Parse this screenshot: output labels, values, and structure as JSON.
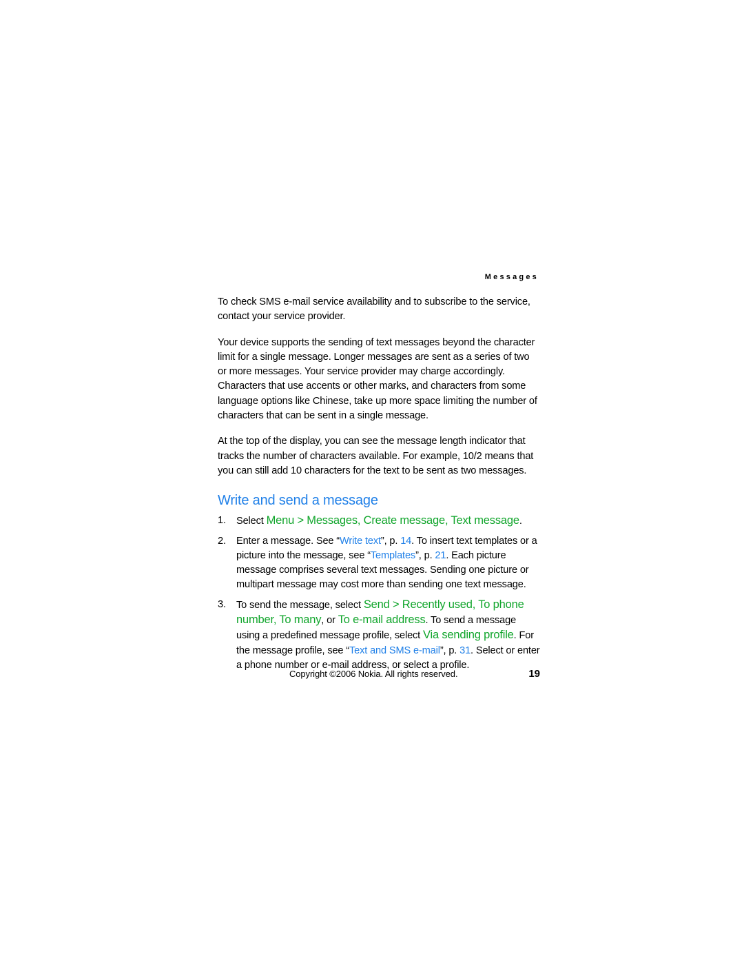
{
  "document": {
    "running_header": "Messages",
    "page_number": "19",
    "copyright": "Copyright ©2006 Nokia. All rights reserved."
  },
  "colors": {
    "heading_blue": "#2080e8",
    "link_blue": "#2080e8",
    "menu_green": "#10a52b",
    "body_black": "#000000",
    "page_background": "#ffffff"
  },
  "paragraphs": [
    {
      "id": "p1",
      "text": "To check SMS e-mail service availability and to subscribe to the service, contact your service provider."
    },
    {
      "id": "p2",
      "text": "Your device supports the sending of text messages beyond the character limit for a single message. Longer messages are sent as a series of two or more messages. Your service provider may charge accordingly. Characters that use accents or other marks, and characters from some language options like Chinese, take up more space limiting the number of characters that can be sent in a single message."
    },
    {
      "id": "p3",
      "text": "At the top of the display, you can see the message length indicator that tracks the number of characters available. For example, 10/2 means that you can still add 10 characters for the text to be sent as two messages."
    }
  ],
  "section": {
    "heading": "Write and send a message"
  },
  "steps": [
    {
      "number": "1.",
      "parts": [
        {
          "type": "text",
          "value": "Select "
        },
        {
          "type": "menu",
          "value": "Menu"
        },
        {
          "type": "menu",
          "value": " > "
        },
        {
          "type": "menu",
          "value": "Messages"
        },
        {
          "type": "menu",
          "value": ", "
        },
        {
          "type": "menu",
          "value": "Create message"
        },
        {
          "type": "menu",
          "value": ", "
        },
        {
          "type": "menu",
          "value": "Text message"
        },
        {
          "type": "text",
          "value": "."
        }
      ]
    },
    {
      "number": "2.",
      "parts": [
        {
          "type": "text",
          "value": "Enter a message. See “"
        },
        {
          "type": "link",
          "value": "Write text"
        },
        {
          "type": "text",
          "value": "”, p. "
        },
        {
          "type": "link",
          "value": "14"
        },
        {
          "type": "text",
          "value": ". To insert text templates or a picture into the message, see “"
        },
        {
          "type": "link",
          "value": "Templates"
        },
        {
          "type": "text",
          "value": "”, p. "
        },
        {
          "type": "link",
          "value": "21"
        },
        {
          "type": "text",
          "value": ". Each picture message comprises several text messages. Sending one picture or multipart message may cost more than sending one text message."
        }
      ]
    },
    {
      "number": "3.",
      "parts": [
        {
          "type": "text",
          "value": "To send the message, select "
        },
        {
          "type": "menu",
          "value": "Send"
        },
        {
          "type": "menu",
          "value": " > "
        },
        {
          "type": "menu",
          "value": "Recently used"
        },
        {
          "type": "menu",
          "value": ", "
        },
        {
          "type": "menu",
          "value": "To phone number"
        },
        {
          "type": "menu",
          "value": ", "
        },
        {
          "type": "menu",
          "value": "To many"
        },
        {
          "type": "text",
          "value": ", or "
        },
        {
          "type": "menu",
          "value": "To e-mail address"
        },
        {
          "type": "text",
          "value": ". To send a message using a predefined message profile, select "
        },
        {
          "type": "menu",
          "value": "Via sending profile"
        },
        {
          "type": "text",
          "value": ". For the message profile, see “"
        },
        {
          "type": "link",
          "value": "Text and SMS e-mail"
        },
        {
          "type": "text",
          "value": "”, p. "
        },
        {
          "type": "link",
          "value": "31"
        },
        {
          "type": "text",
          "value": ". Select or enter a phone number or e-mail address, or select a profile."
        }
      ]
    }
  ]
}
